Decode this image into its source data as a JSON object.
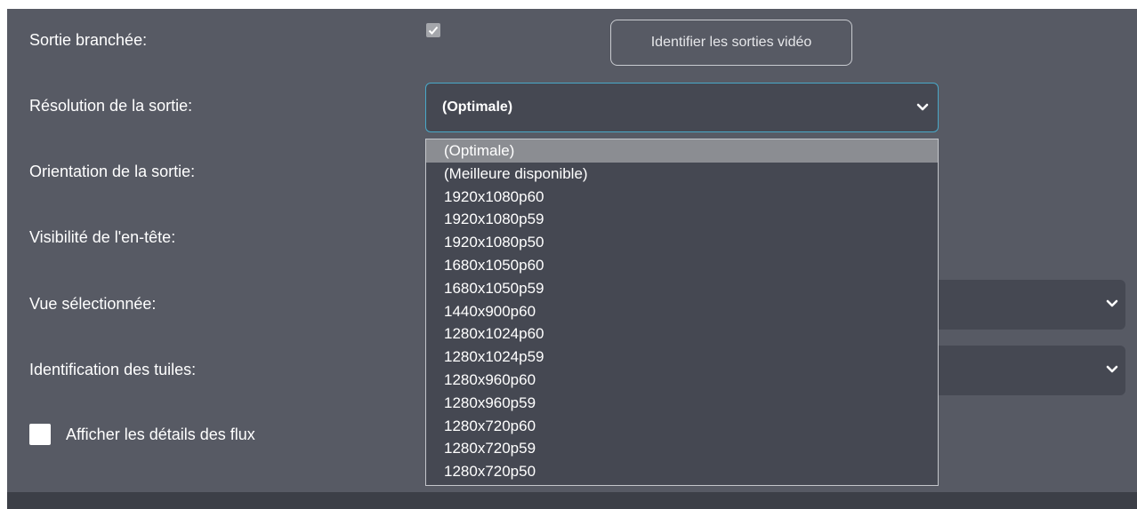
{
  "settings": {
    "rows": [
      {
        "label": "Sortie branchée:"
      },
      {
        "label": "Résolution de la sortie:"
      },
      {
        "label": "Orientation de la sortie:"
      },
      {
        "label": "Visibilité de l'en-tête:"
      },
      {
        "label": "Vue sélectionnée:"
      },
      {
        "label": "Identification des tuiles:"
      }
    ],
    "connected_checked": true,
    "identify_button_label": "Identifier les sorties vidéo",
    "resolution_selected": "(Optimale)",
    "show_stream_details_label": "Afficher les détails des flux",
    "show_stream_details_checked": false
  },
  "resolution_options": [
    "(Optimale)",
    "(Meilleure disponible)",
    "1920x1080p60",
    "1920x1080p59",
    "1920x1080p50",
    "1680x1050p60",
    "1680x1050p59",
    "1440x900p60",
    "1280x1024p60",
    "1280x1024p59",
    "1280x960p60",
    "1280x960p59",
    "1280x720p60",
    "1280x720p59",
    "1280x720p50"
  ],
  "icons": {
    "checkbox_check": "check-icon",
    "dropdown_arrow": "chevron-down-icon"
  },
  "colors": {
    "panel_bg": "#575a64",
    "select_bg": "#454852",
    "focus_border": "#49a8c8",
    "selected_option_bg": "#8b8d92"
  }
}
